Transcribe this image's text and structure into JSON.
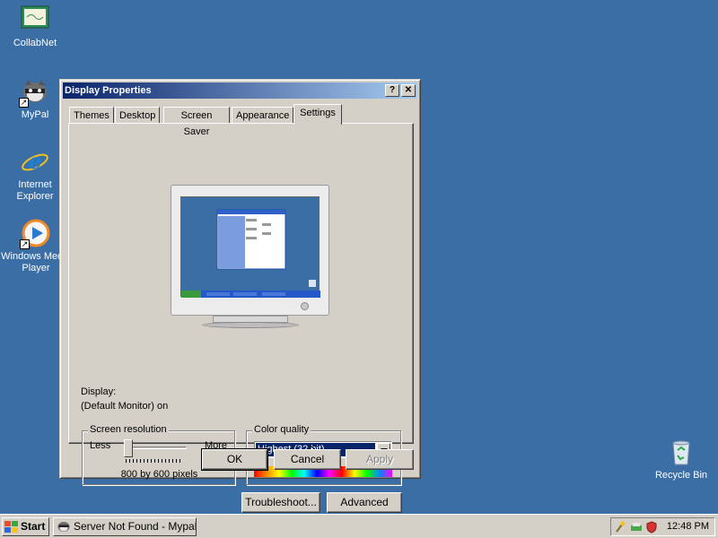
{
  "desktop": {
    "icons": [
      {
        "label": "CollabNet",
        "icon": "certificate-icon"
      },
      {
        "label": "MyPal",
        "icon": "raccoon-icon"
      },
      {
        "label": "Internet Explorer",
        "icon": "internet-explorer-icon"
      },
      {
        "label": "Windows Media Player",
        "icon": "media-player-icon"
      },
      {
        "label": "Recycle Bin",
        "icon": "recycle-bin-icon"
      }
    ]
  },
  "dialog": {
    "title": "Display Properties",
    "help_glyph": "?",
    "close_glyph": "✕",
    "tabs": [
      "Themes",
      "Desktop",
      "Screen Saver",
      "Appearance",
      "Settings"
    ],
    "active_tab": "Settings",
    "display_label": "Display:",
    "display_value": "(Default Monitor) on",
    "resolution": {
      "group_label": "Screen resolution",
      "less": "Less",
      "more": "More",
      "value_text": "800 by 600 pixels",
      "slider_level": 0
    },
    "color": {
      "group_label": "Color quality",
      "selected": "Highest (32 bit)"
    },
    "buttons": {
      "troubleshoot": "Troubleshoot...",
      "advanced": "Advanced",
      "ok": "OK",
      "cancel": "Cancel",
      "apply": "Apply"
    }
  },
  "taskbar": {
    "start": "Start",
    "task": "Server Not Found - Mypal",
    "clock": "12:48 PM"
  },
  "colors": {
    "desktop": "#3a6ea5",
    "title_start": "#0a246a",
    "title_end": "#a6caf0",
    "face": "#d4d0c8"
  }
}
